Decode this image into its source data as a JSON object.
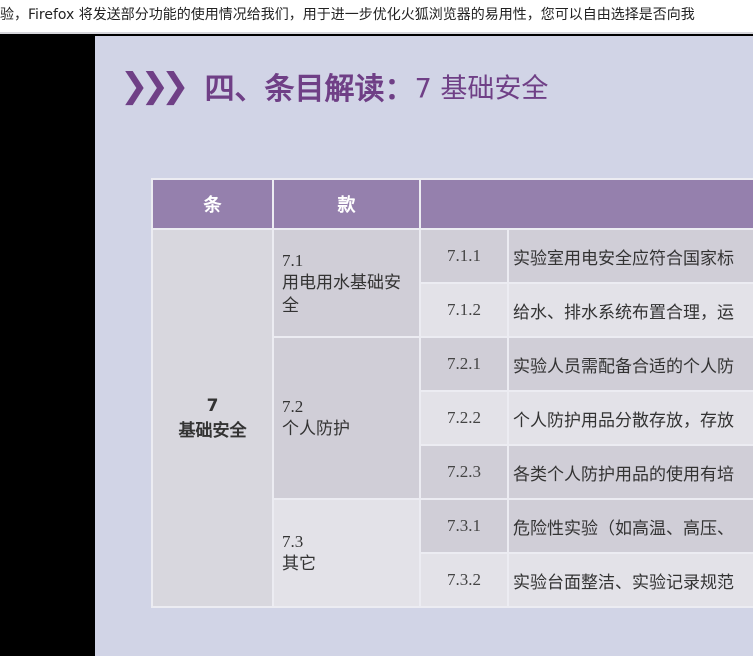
{
  "notice": "验，Firefox 将发送部分功能的使用情况给我们，用于进一步优化火狐浏览器的易用性，您可以自由选择是否向我",
  "slide": {
    "title_icon": "triple-chevron-right",
    "title_main": "四、条目解读：",
    "title_sub": "7 基础安全",
    "headers": [
      "条",
      "款",
      ""
    ],
    "article": {
      "num": "7",
      "name": "基础安全"
    },
    "clauses": [
      {
        "num": "7.1",
        "name": "用电用水基础安全",
        "items": [
          {
            "num": "7.1.1",
            "text": "实验室用电安全应符合国家标"
          },
          {
            "num": "7.1.2",
            "text": "给水、排水系统布置合理，运"
          }
        ]
      },
      {
        "num": "7.2",
        "name": "个人防护",
        "items": [
          {
            "num": "7.2.1",
            "text": "实验人员需配备合适的个人防"
          },
          {
            "num": "7.2.2",
            "text": "个人防护用品分散存放，存放"
          },
          {
            "num": "7.2.3",
            "text": "各类个人防护用品的使用有培"
          }
        ]
      },
      {
        "num": "7.3",
        "name": "其它",
        "items": [
          {
            "num": "7.3.1",
            "text": "危险性实验（如高温、高压、"
          },
          {
            "num": "7.3.2",
            "text": "实验台面整洁、实验记录规范"
          }
        ]
      }
    ]
  }
}
